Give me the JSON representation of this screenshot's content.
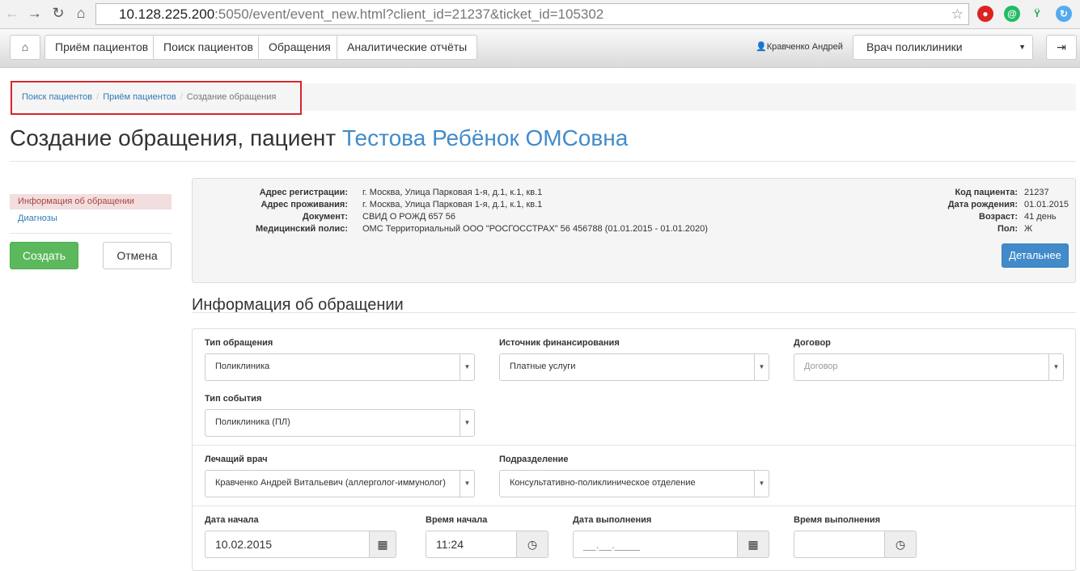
{
  "browser": {
    "url_host": "10.128.225.200",
    "url_rest": ":5050/event/event_new.html?client_id=21237&ticket_id=105302"
  },
  "navbar": {
    "items": [
      "Приём пациентов",
      "Поиск пациентов",
      "Обращения",
      "Аналитические отчёты"
    ],
    "user": "Кравченко Андрей",
    "role": "Врач поликлиники"
  },
  "breadcrumb": {
    "items": [
      "Поиск пациентов",
      "Приём пациентов"
    ],
    "current": "Создание обращения"
  },
  "title": {
    "prefix": "Создание обращения, пациент",
    "patient": "Тестова Ребёнок ОМСовна"
  },
  "sidebar": {
    "items": [
      "Информация об обращении",
      "Диагнозы"
    ],
    "create": "Создать",
    "cancel": "Отмена"
  },
  "patient": {
    "left": [
      {
        "label": "Адрес регистрации:",
        "value": "г. Москва, Улица Парковая 1-я, д.1, к.1, кв.1"
      },
      {
        "label": "Адрес проживания:",
        "value": "г. Москва, Улица Парковая 1-я, д.1, к.1, кв.1"
      },
      {
        "label": "Документ:",
        "value": "СВИД О РОЖД 657 56"
      },
      {
        "label": "Медицинский полис:",
        "value": "ОМС Территориальный ООО \"РОСГОССТРАХ\" 56 456788 (01.01.2015 - 01.01.2020)"
      }
    ],
    "right": [
      {
        "label": "Код пациента:",
        "value": "21237"
      },
      {
        "label": "Дата рождения:",
        "value": "01.01.2015"
      },
      {
        "label": "Возраст:",
        "value": "41 день"
      },
      {
        "label": "Пол:",
        "value": "Ж"
      }
    ],
    "details": "Детальнее"
  },
  "section": "Информация об обращении",
  "form": {
    "type_label": "Тип обращения",
    "type_value": "Поликлиника",
    "fin_label": "Источник финансирования",
    "fin_value": "Платные услуги",
    "contract_label": "Договор",
    "contract_placeholder": "Договор",
    "event_label": "Тип события",
    "event_value": "Поликлиника (ПЛ)",
    "doctor_label": "Лечащий врач",
    "doctor_value": "Кравченко Андрей Витальевич (аллерголог-иммунолог)",
    "dept_label": "Подразделение",
    "dept_value": "Консультативно-поликлиническое отделение",
    "start_date_label": "Дата начала",
    "start_date": "10.02.2015",
    "start_time_label": "Время начала",
    "start_time": "11:24",
    "end_date_label": "Дата выполнения",
    "end_date_placeholder": "__.__.____",
    "end_time_label": "Время выполнения"
  }
}
